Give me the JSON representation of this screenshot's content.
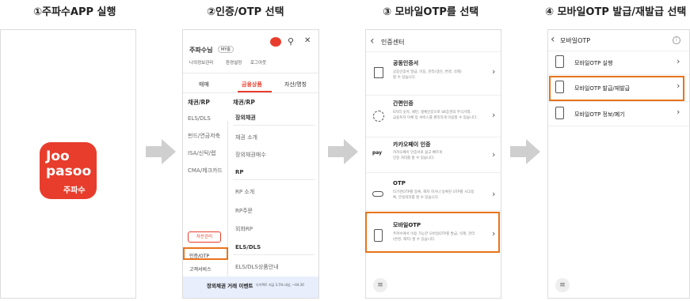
{
  "steps": [
    {
      "title": "①주파수APP 실행"
    },
    {
      "title": "②인증/OTP 선택"
    },
    {
      "title": "③ 모바일OTP를 선택"
    },
    {
      "title": "④ 모바일OTP 발급/재발급 선택"
    }
  ],
  "app": {
    "logo_line1": "Joo",
    "logo_line2": "pasoo",
    "logo_label": "주파수",
    "brand_color": "#e83d2c"
  },
  "menu": {
    "user_name": "주파수님",
    "grade_badge": "MY홈",
    "links": [
      "나의정보관리",
      "환경설정",
      "로그아웃"
    ],
    "tabs": [
      "매매",
      "금융상품",
      "자산/명칭"
    ],
    "left_items": [
      "채권/RP",
      "ELS/DLS",
      "펀드/연금저축",
      "ISA/신탁/랩",
      "CMA/제크카드"
    ],
    "right_header": "채권/RP",
    "right_items": [
      "장외채권",
      "채권 소개",
      "장외채권매수",
      "RP",
      "RP 소개",
      "RP주문",
      "외화RP",
      "ELS/DLS",
      "ELS/DLS상품안내"
    ],
    "asset_button": "자산관리",
    "auth_otp": "인증/OTP",
    "customer_service": "고객서비스",
    "banner_text": "장외채권 거래 이벤트",
    "banner_sub": "다이렉트 지급 3.5% 대상, ~04.30",
    "accent": "#e8731a"
  },
  "auth_center": {
    "title": "인증센터",
    "items": [
      {
        "title": "공동인증서",
        "desc": [
          "공동인증서 발급, 이동, 관리(갱신, 변경, 삭제)",
          "할 수 있습니다."
        ]
      },
      {
        "title": "간편인증",
        "desc": [
          "6자리 숫자, 패턴, 생체인증으로 SK증권의 주식거래,",
          "금융투자 이체 등 서비스를 편리하게 이용할 수 있습니다."
        ]
      },
      {
        "title": "카카오페이 인증",
        "desc": [
          "카카오페이 인증서로 쉽고 빠르게",
          "인증 처리를 할 수 있습니다."
        ]
      },
      {
        "title": "OTP",
        "desc": [
          "타기관OTP를 등록, 해지 하거나 등록된 OTP를 사고등",
          "록, 분실처리를 할 수 있습니다."
        ]
      },
      {
        "title": "모바일OTP",
        "desc": [
          "주파수에서 이용 가능한 모바일OTP를 발급, 삭제, 관리",
          "(변경, 해지) 할 수 있습니다."
        ]
      }
    ],
    "kakao_pay": "pay"
  },
  "mobile_otp": {
    "title": "모바일OTP",
    "items": [
      "모바일OTP 실행",
      "모바일OTP 발급/재발급",
      "모바일OTP 정보/폐기"
    ]
  },
  "icons": {
    "menu": "≡",
    "back": "‹",
    "chevron": "›",
    "search": "⚲",
    "close": "✕",
    "info": "i"
  }
}
